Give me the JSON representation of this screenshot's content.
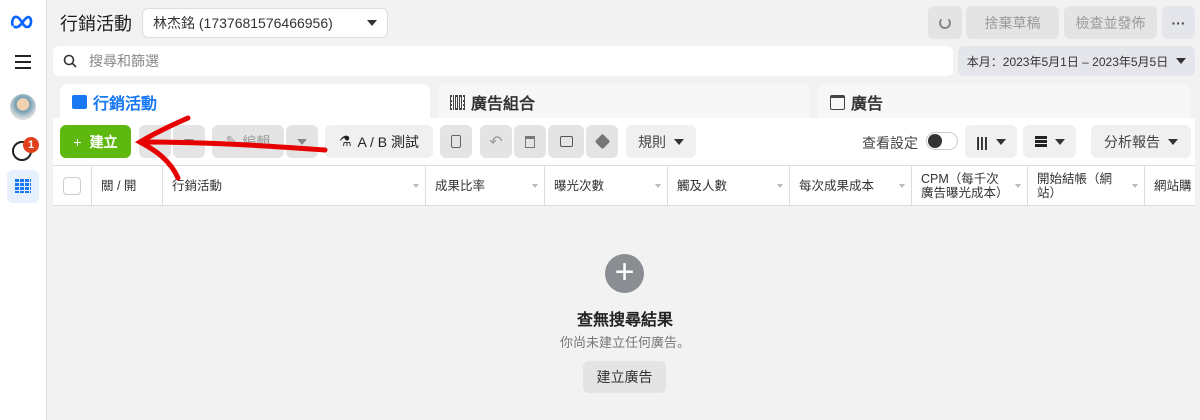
{
  "sidebar": {
    "badge": "1"
  },
  "header": {
    "title": "行銷活動",
    "account": "林杰銘 (1737681576466956)",
    "discard": "捨棄草稿",
    "review": "檢查並發佈",
    "more": "···"
  },
  "search": {
    "placeholder": "搜尋和篩選"
  },
  "date_range": "本月：2023年5月1日 – 2023年5月5日",
  "tabs": [
    {
      "label": "行銷活動"
    },
    {
      "label": "廣告組合"
    },
    {
      "label": "廣告"
    }
  ],
  "toolbar": {
    "create": "建立",
    "edit": "編輯",
    "ab_test": "A / B 測試",
    "rules": "規則",
    "view_settings": "查看設定",
    "reports": "分析報告"
  },
  "columns": [
    "關 / 開",
    "行銷活動",
    "成果比率",
    "曝光次數",
    "觸及人數",
    "每次成果成本",
    "CPM（每千次廣告曝光成本）",
    "開始結帳（網站）",
    "網站購"
  ],
  "empty": {
    "title": "查無搜尋結果",
    "subtitle": "你尚未建立任何廣告。",
    "button": "建立廣告"
  },
  "colors": {
    "accent": "#1877f2",
    "create": "#5fb80f",
    "annotation": "#e60000"
  }
}
